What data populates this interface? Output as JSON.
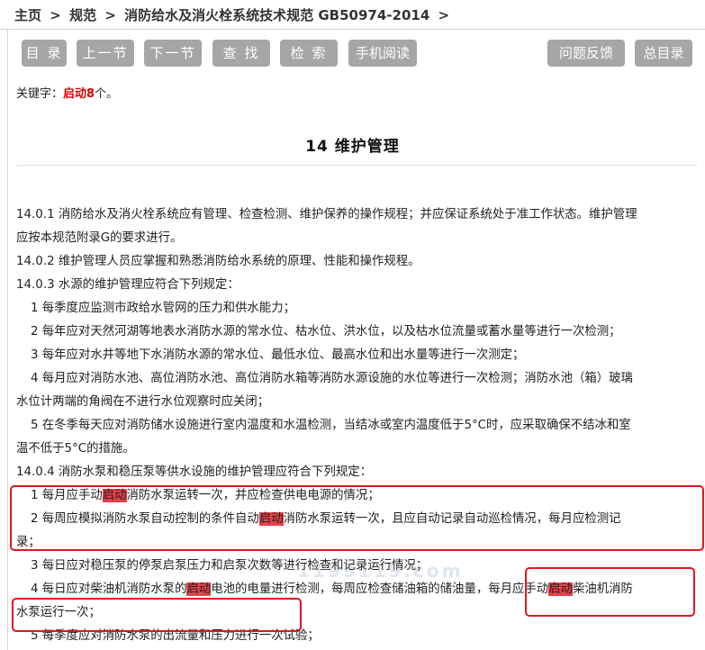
{
  "breadcrumb": {
    "home": "主页",
    "section": "规范",
    "doc": "消防给水及消火栓系统技术规范 GB50974-2014",
    "sep": ">"
  },
  "toolbar": {
    "toc": "目 录",
    "prev": "上一节",
    "next": "下一节",
    "find": "查 找",
    "search": "检 索",
    "mobile": "手机阅读",
    "feedback": "问题反馈",
    "master_toc": "总目录"
  },
  "keyword": {
    "label": "关键字：",
    "word": "启动",
    "count": "8",
    "suffix": "个。"
  },
  "title": "14 维护管理",
  "lines": [
    {
      "parts": [
        "14.0.1 消防给水及消火栓系统应有管理、检查检测、维护保养的操作规程；并应保证系统处于准工作状态。维护管理"
      ]
    },
    {
      "parts": [
        "应按本规范附录G的要求进行。"
      ]
    },
    {
      "parts": [
        "14.0.2 维护管理人员应掌握和熟悉消防给水系统的原理、性能和操作规程。"
      ]
    },
    {
      "parts": [
        "14.0.3 水源的维护管理应符合下列规定："
      ]
    },
    {
      "parts": [
        "1 每季度应监测市政给水管网的压力和供水能力；"
      ]
    },
    {
      "parts": [
        "2 每年应对天然河湖等地表水消防水源的常水位、枯水位、洪水位，以及枯水位流量或蓄水量等进行一次检测；"
      ]
    },
    {
      "parts": [
        "3 每年应对水井等地下水消防水源的常水位、最低水位、最高水位和出水量等进行一次测定；"
      ]
    },
    {
      "parts": [
        "4 每月应对消防水池、高位消防水池、高位消防水箱等消防水源设施的水位等进行一次检测；消防水池（箱）玻璃"
      ]
    },
    {
      "parts": [
        "水位计两端的角阀在不进行水位观察时应关闭；"
      ]
    },
    {
      "parts": [
        "5 在冬季每天应对消防储水设施进行室内温度和水温检测，当结冰或室内温度低于5°C时，应采取确保不结冰和室"
      ]
    },
    {
      "parts": [
        "温不低于5°C的措施。"
      ]
    },
    {
      "parts": [
        "14.0.4 消防水泵和稳压泵等供水设施的维护管理应符合下列规定："
      ]
    },
    {
      "parts": [
        "1 每月应手动",
        "启动",
        "消防水泵运转一次，并应检查供电电源的情况；"
      ]
    },
    {
      "parts": [
        "2 每周应模拟消防水泵自动控制的条件自动",
        "启动",
        "消防水泵运转一次，且应自动记录自动巡检情况，每月应检测记"
      ]
    },
    {
      "parts": [
        "录；"
      ]
    },
    {
      "parts": [
        "3 每日应对稳压泵的停泵启泵压力和启泵次数等进行检查和记录运行情况；"
      ]
    },
    {
      "parts": [
        "4 每日应对柴油机消防水泵的",
        "启动",
        "电池的电量进行检测，每周应检查储油箱的储油量，每月应手动",
        "启动",
        "柴油机消防"
      ]
    },
    {
      "parts": [
        "水泵运行一次；"
      ]
    },
    {
      "parts": [
        "5 每季度应对消防水泵的出流量和压力进行一次试验；"
      ]
    }
  ],
  "watermark": "1199119.com",
  "colors": {
    "button_bg": "#a6a6a6",
    "highlight": "#e64048",
    "keyword": "#e00000",
    "annotation_box": "#e0161e"
  }
}
